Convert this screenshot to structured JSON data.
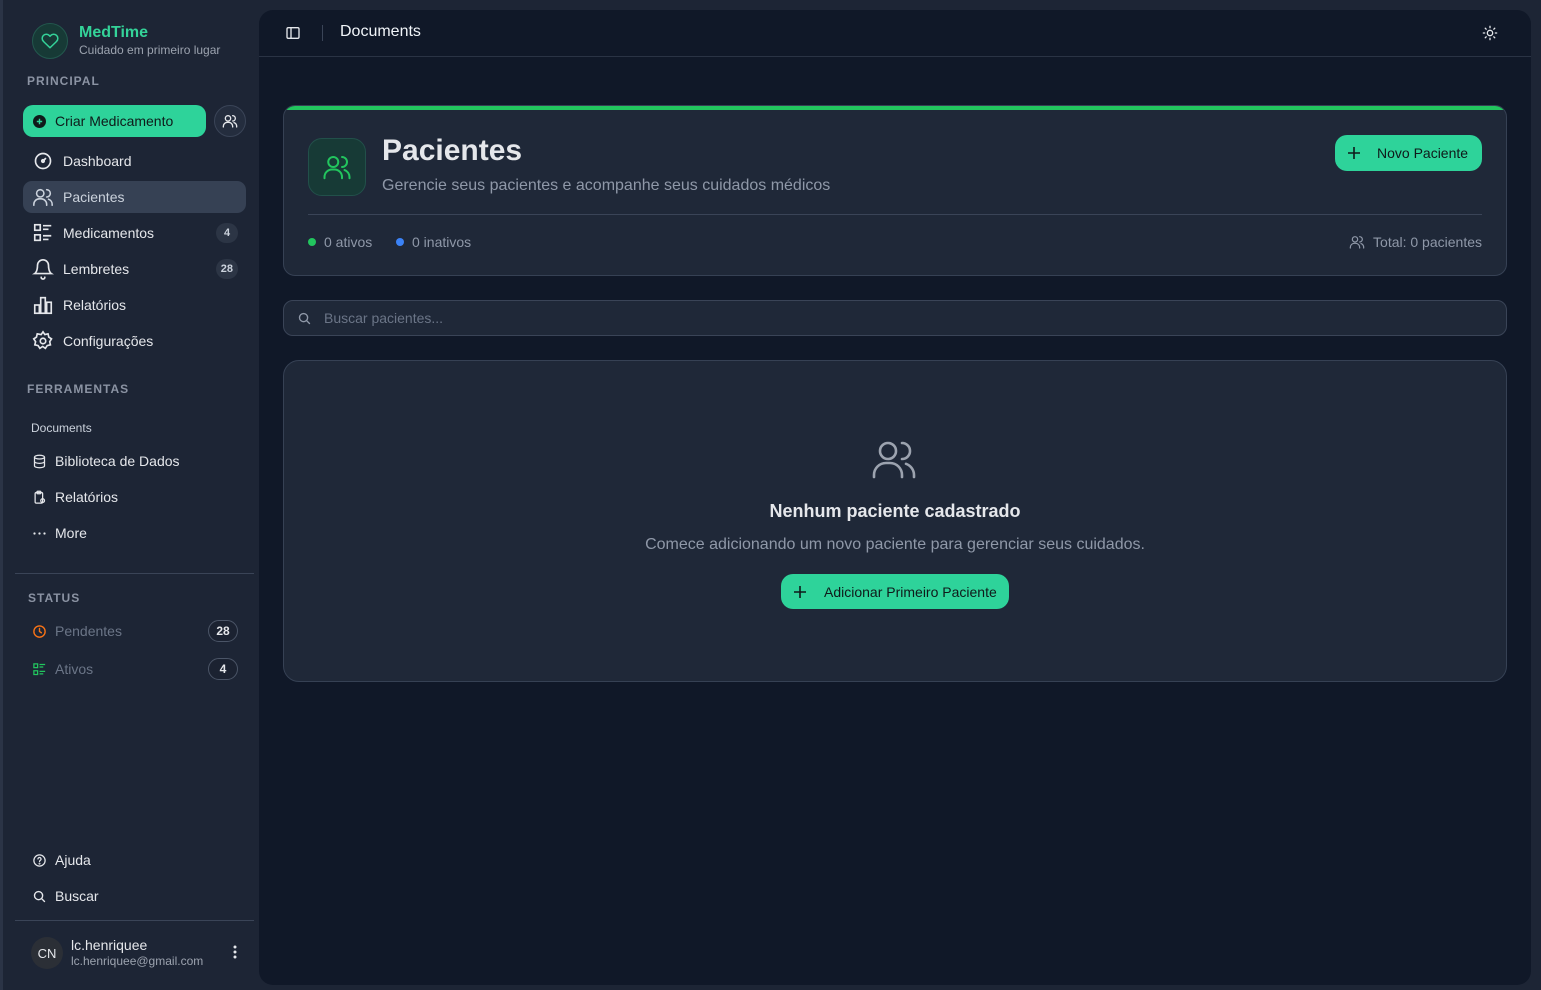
{
  "brand": {
    "name": "MedTime",
    "tagline": "Cuidado em primeiro lugar"
  },
  "sidebar": {
    "principal_label": "PRINCIPAL",
    "create_button": "Criar Medicamento",
    "nav": [
      {
        "label": "Dashboard",
        "icon": "gauge-icon"
      },
      {
        "label": "Pacientes",
        "icon": "users-icon",
        "active": true
      },
      {
        "label": "Medicamentos",
        "icon": "list-icon",
        "badge": "4"
      },
      {
        "label": "Lembretes",
        "icon": "bell-icon",
        "badge": "28"
      },
      {
        "label": "Relatórios",
        "icon": "bar-chart-icon"
      },
      {
        "label": "Configurações",
        "icon": "gear-icon"
      }
    ],
    "tools_label": "FERRAMENTAS",
    "documents_label": "Documents",
    "tools": [
      {
        "label": "Biblioteca de Dados",
        "icon": "database-icon"
      },
      {
        "label": "Relatórios",
        "icon": "clipboard-icon"
      },
      {
        "label": "More",
        "icon": "more-horizontal-icon"
      }
    ],
    "status_label": "STATUS",
    "status": [
      {
        "label": "Pendentes",
        "badge": "28",
        "icon": "clock-icon",
        "color": "#f97316"
      },
      {
        "label": "Ativos",
        "badge": "4",
        "icon": "list-icon",
        "color": "#22c55e"
      }
    ],
    "help": "Ajuda",
    "search": "Buscar",
    "user": {
      "initials": "CN",
      "name": "lc.henriquee",
      "email": "lc.henriquee@gmail.com"
    }
  },
  "topbar": {
    "breadcrumb": "Documents"
  },
  "header": {
    "title": "Pacientes",
    "subtitle": "Gerencie seus pacientes e acompanhe seus cuidados médicos",
    "new_button": "Novo Paciente",
    "active_stat": "0 ativos",
    "inactive_stat": "0 inativos",
    "total": "Total: 0 pacientes"
  },
  "search": {
    "placeholder": "Buscar pacientes..."
  },
  "empty": {
    "title": "Nenhum paciente cadastrado",
    "subtitle": "Comece adicionando um novo paciente para gerenciar seus cuidados.",
    "button": "Adicionar Primeiro Paciente"
  },
  "colors": {
    "accent": "#2ed39a",
    "brand": "#34d399",
    "active_dot": "#22c55e",
    "inactive_dot": "#3b82f6",
    "pending": "#f97316"
  }
}
